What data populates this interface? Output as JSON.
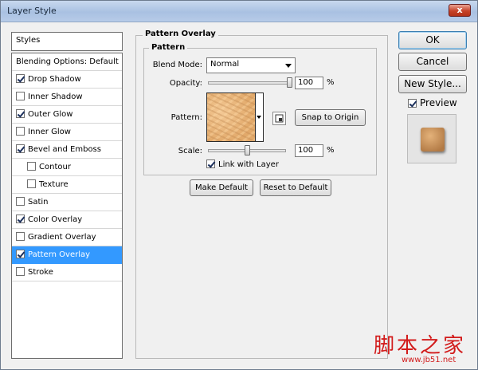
{
  "window": {
    "title": "Layer Style",
    "close_label": "x"
  },
  "styles_header": "Styles",
  "style_items": [
    {
      "label": "Blending Options: Default",
      "checkbox": false,
      "checked": false,
      "sub": false,
      "selected": false
    },
    {
      "label": "Drop Shadow",
      "checkbox": true,
      "checked": true,
      "sub": false,
      "selected": false
    },
    {
      "label": "Inner Shadow",
      "checkbox": true,
      "checked": false,
      "sub": false,
      "selected": false
    },
    {
      "label": "Outer Glow",
      "checkbox": true,
      "checked": true,
      "sub": false,
      "selected": false
    },
    {
      "label": "Inner Glow",
      "checkbox": true,
      "checked": false,
      "sub": false,
      "selected": false
    },
    {
      "label": "Bevel and Emboss",
      "checkbox": true,
      "checked": true,
      "sub": false,
      "selected": false
    },
    {
      "label": "Contour",
      "checkbox": true,
      "checked": false,
      "sub": true,
      "selected": false
    },
    {
      "label": "Texture",
      "checkbox": true,
      "checked": false,
      "sub": true,
      "selected": false
    },
    {
      "label": "Satin",
      "checkbox": true,
      "checked": false,
      "sub": false,
      "selected": false
    },
    {
      "label": "Color Overlay",
      "checkbox": true,
      "checked": true,
      "sub": false,
      "selected": false
    },
    {
      "label": "Gradient Overlay",
      "checkbox": true,
      "checked": false,
      "sub": false,
      "selected": false
    },
    {
      "label": "Pattern Overlay",
      "checkbox": true,
      "checked": true,
      "sub": false,
      "selected": true
    },
    {
      "label": "Stroke",
      "checkbox": true,
      "checked": false,
      "sub": false,
      "selected": false
    }
  ],
  "pattern_overlay": {
    "group_title": "Pattern Overlay",
    "subgroup_title": "Pattern",
    "blend_mode_label": "Blend Mode:",
    "blend_mode_value": "Normal",
    "opacity_label": "Opacity:",
    "opacity_value": "100",
    "opacity_unit": "%",
    "opacity_fraction": 1.0,
    "pattern_label": "Pattern:",
    "snap_label": "Snap to Origin",
    "scale_label": "Scale:",
    "scale_value": "100",
    "scale_unit": "%",
    "scale_fraction": 0.5,
    "link_label": "Link with Layer",
    "link_checked": true,
    "make_default_label": "Make Default",
    "reset_default_label": "Reset to Default"
  },
  "right_panel": {
    "ok_label": "OK",
    "cancel_label": "Cancel",
    "new_style_label": "New Style...",
    "preview_label": "Preview",
    "preview_checked": true
  },
  "watermark": {
    "text": "脚本之家",
    "url": "www.jb51.net"
  },
  "colors": {
    "selection": "#3399ff",
    "watermark": "#d21b1b",
    "titlebar": "#a9c1e2"
  }
}
